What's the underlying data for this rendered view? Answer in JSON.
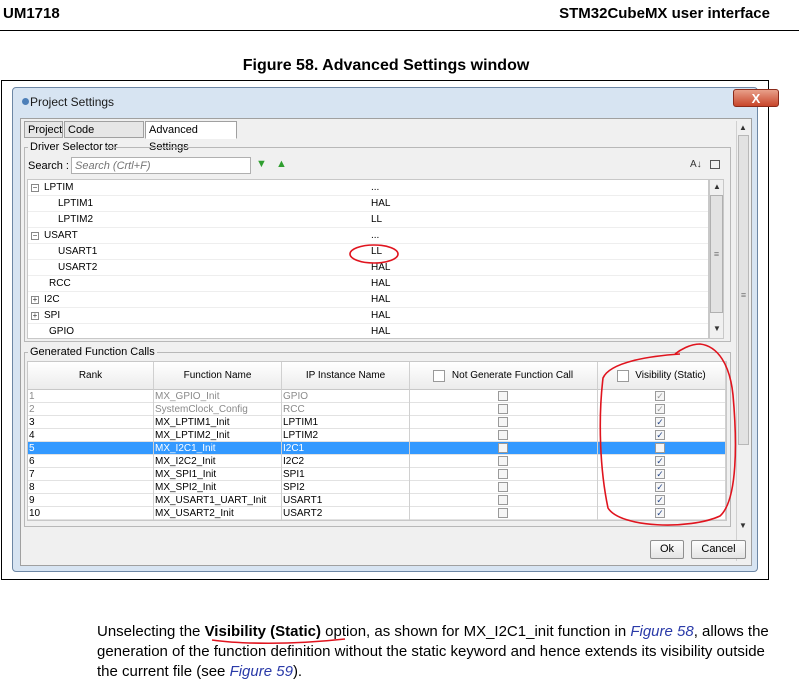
{
  "header": {
    "left": "UM1718",
    "right": "STM32CubeMX user interface"
  },
  "figure_title": "Figure 58. Advanced Settings window",
  "window": {
    "title": "Project Settings",
    "close_label": "X",
    "tabs": [
      "Project",
      "Code Generator",
      "Advanced Settings"
    ],
    "active_tab": "Advanced Settings"
  },
  "driver_selector": {
    "legend": "Driver Selector",
    "search_label": "Search :",
    "search_placeholder": "Search (Crtl+F)",
    "sort_icon": "A↓",
    "rows": [
      {
        "name": "LPTIM",
        "value": "...",
        "toggle": "−"
      },
      {
        "name": "LPTIM1",
        "value": "HAL"
      },
      {
        "name": "LPTIM2",
        "value": "LL"
      },
      {
        "name": "USART",
        "value": "...",
        "toggle": "−"
      },
      {
        "name": "USART1",
        "value": "LL"
      },
      {
        "name": "USART2",
        "value": "HAL"
      },
      {
        "name": "RCC",
        "value": "HAL"
      },
      {
        "name": "I2C",
        "value": "HAL",
        "toggle": "+"
      },
      {
        "name": "SPI",
        "value": "HAL",
        "toggle": "+"
      },
      {
        "name": "GPIO",
        "value": "HAL"
      }
    ]
  },
  "generated_calls": {
    "legend": "Generated Function Calls",
    "columns": [
      "Rank",
      "Function Name",
      "IP Instance Name",
      "Not Generate Function Call",
      "Visibility (Static)"
    ],
    "rows": [
      {
        "rank": "1",
        "function": "MX_GPIO_Init",
        "instance": "GPIO",
        "not_generate": false,
        "visibility": true
      },
      {
        "rank": "2",
        "function": "SystemClock_Config",
        "instance": "RCC",
        "not_generate": false,
        "visibility": true
      },
      {
        "rank": "3",
        "function": "MX_LPTIM1_Init",
        "instance": "LPTIM1",
        "not_generate": false,
        "visibility": true
      },
      {
        "rank": "4",
        "function": "MX_LPTIM2_Init",
        "instance": "LPTIM2",
        "not_generate": false,
        "visibility": true
      },
      {
        "rank": "5",
        "function": "MX_I2C1_Init",
        "instance": "I2C1",
        "not_generate": false,
        "visibility": false
      },
      {
        "rank": "6",
        "function": "MX_I2C2_Init",
        "instance": "I2C2",
        "not_generate": false,
        "visibility": true
      },
      {
        "rank": "7",
        "function": "MX_SPI1_Init",
        "instance": "SPI1",
        "not_generate": false,
        "visibility": true
      },
      {
        "rank": "8",
        "function": "MX_SPI2_Init",
        "instance": "SPI2",
        "not_generate": false,
        "visibility": true
      },
      {
        "rank": "9",
        "function": "MX_USART1_UART_Init",
        "instance": "USART1",
        "not_generate": false,
        "visibility": true
      },
      {
        "rank": "10",
        "function": "MX_USART2_Init",
        "instance": "USART2",
        "not_generate": false,
        "visibility": true
      }
    ],
    "selected_rank": "5"
  },
  "buttons": {
    "ok": "Ok",
    "cancel": "Cancel"
  },
  "paragraph": {
    "p1": "Unselecting the ",
    "p2": "Visibility (Static)",
    "p3": " option, as shown for MX_I2C1_init function in ",
    "p4": "Figure 58",
    "p5": ", allows the generation of the function definition without the static keyword and hence extends its visibility outside the current file (see ",
    "p6": "Figure 59",
    "p7": ")."
  },
  "colors": {
    "selection": "#3399ff",
    "annotation": "#e0141e",
    "link": "#2a3aa8"
  }
}
